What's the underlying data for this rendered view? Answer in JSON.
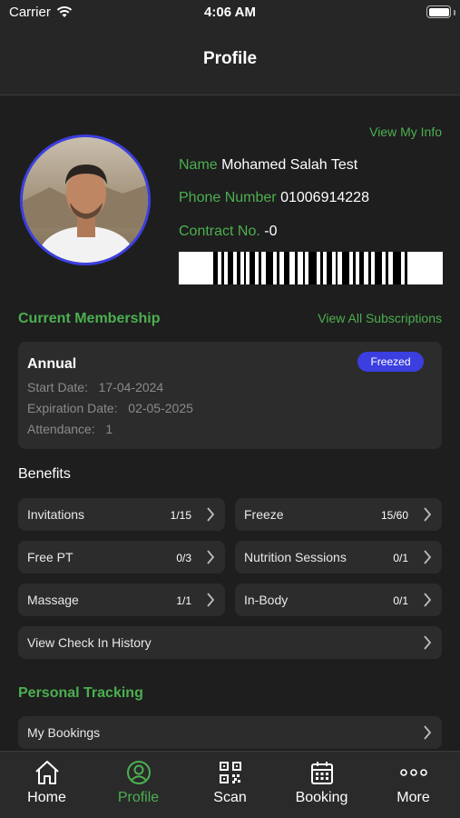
{
  "status": {
    "carrier": "Carrier",
    "time": "4:06 AM"
  },
  "nav": {
    "title": "Profile"
  },
  "profile": {
    "view_info_link": "View My Info",
    "name_label": "Name",
    "name_value": "Mohamed Salah Test",
    "phone_label": "Phone Number",
    "phone_value": "01006914228",
    "contract_label": "Contract No.",
    "contract_value": "-0"
  },
  "membership": {
    "section_title": "Current Membership",
    "view_all_link": "View All Subscriptions",
    "plan_name": "Annual",
    "status_badge": "Freezed",
    "start_label": "Start Date:",
    "start_value": "17-04-2024",
    "expiration_label": "Expiration Date:",
    "expiration_value": "02-05-2025",
    "attendance_label": "Attendance:",
    "attendance_value": "1"
  },
  "benefits": {
    "title": "Benefits",
    "items": [
      {
        "label": "Invitations",
        "count": "1/15"
      },
      {
        "label": "Freeze",
        "count": "15/60"
      },
      {
        "label": "Free PT",
        "count": "0/3"
      },
      {
        "label": "Nutrition Sessions",
        "count": "0/1"
      },
      {
        "label": "Massage",
        "count": "1/1"
      },
      {
        "label": "In-Body",
        "count": "0/1"
      }
    ],
    "check_in_history": "View Check In History"
  },
  "tracking": {
    "title": "Personal Tracking",
    "my_bookings": "My Bookings"
  },
  "tabs": [
    {
      "label": "Home",
      "icon": "home-icon"
    },
    {
      "label": "Profile",
      "icon": "profile-icon",
      "active": true
    },
    {
      "label": "Scan",
      "icon": "qr-code-icon"
    },
    {
      "label": "Booking",
      "icon": "calendar-icon"
    },
    {
      "label": "More",
      "icon": "more-dots-icon"
    }
  ],
  "colors": {
    "accent": "#4caf50",
    "badge": "#3b3fe0",
    "background": "#1e1e1e",
    "card": "#2c2c2c"
  }
}
